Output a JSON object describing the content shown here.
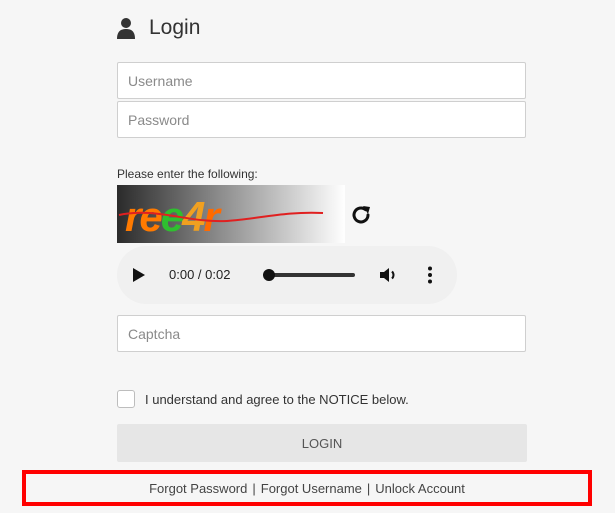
{
  "header": {
    "title": "Login",
    "icon": "user-icon"
  },
  "form": {
    "username_placeholder": "Username",
    "password_placeholder": "Password",
    "captcha_prompt": "Please enter the following:",
    "captcha_text": "ree4r",
    "captcha_input_placeholder": "Captcha",
    "agree_label": "I understand and agree to the NOTICE below.",
    "login_label": "LOGIN"
  },
  "audio": {
    "time": "0:00 / 0:02",
    "progress": 0
  },
  "links": {
    "forgot_password": "Forgot Password",
    "forgot_username": "Forgot Username",
    "unlock_account": "Unlock Account",
    "separator": "|"
  },
  "colors": {
    "highlight": "#ff0000",
    "button_bg": "#e6e6e6",
    "background": "#f6f6f6"
  }
}
